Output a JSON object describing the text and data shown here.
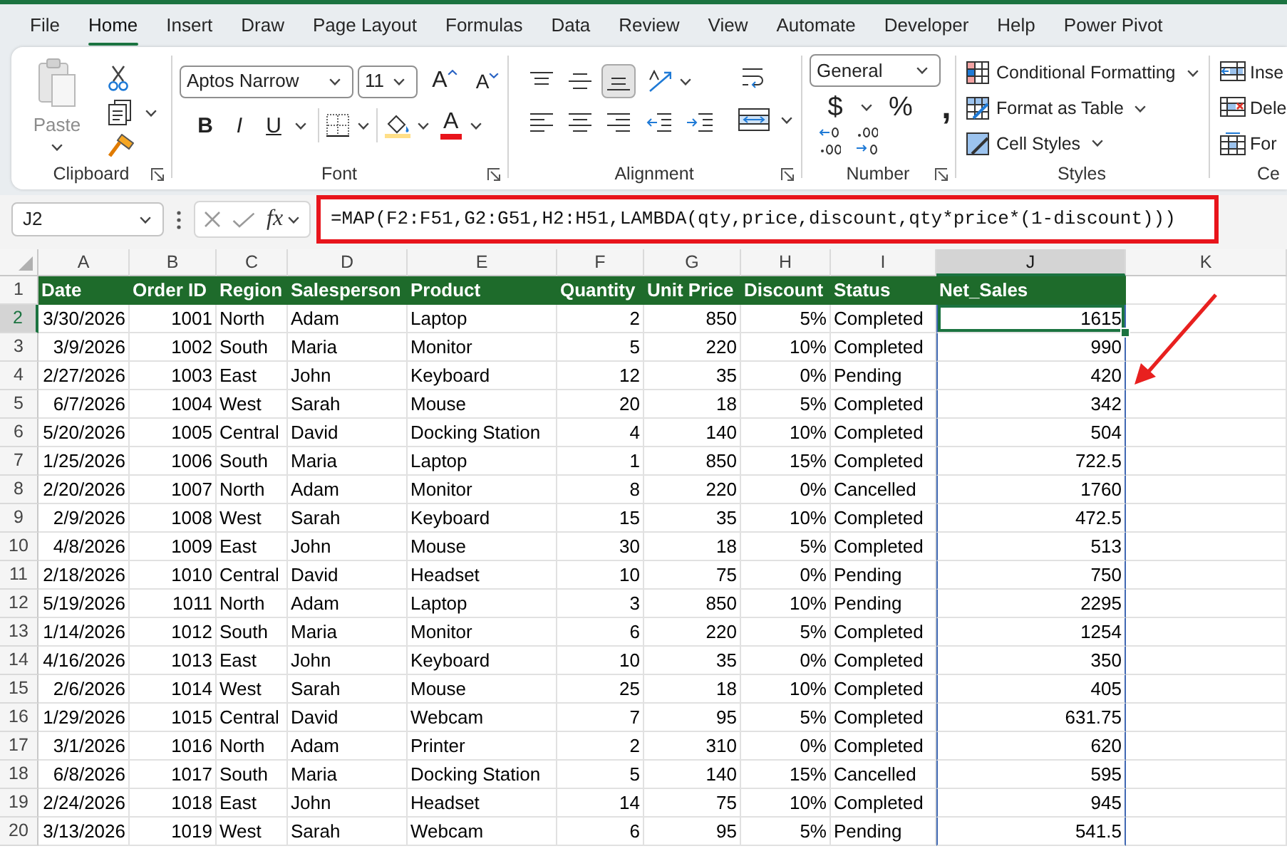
{
  "menu_tabs": [
    {
      "label": "File",
      "selected": false
    },
    {
      "label": "Home",
      "selected": true
    },
    {
      "label": "Insert",
      "selected": false
    },
    {
      "label": "Draw",
      "selected": false
    },
    {
      "label": "Page Layout",
      "selected": false
    },
    {
      "label": "Formulas",
      "selected": false
    },
    {
      "label": "Data",
      "selected": false
    },
    {
      "label": "Review",
      "selected": false
    },
    {
      "label": "View",
      "selected": false
    },
    {
      "label": "Automate",
      "selected": false
    },
    {
      "label": "Developer",
      "selected": false
    },
    {
      "label": "Help",
      "selected": false
    },
    {
      "label": "Power Pivot",
      "selected": false
    }
  ],
  "ribbon": {
    "groups": [
      {
        "kind": "clipboard",
        "label": "Clipboard",
        "launcher": true,
        "paste": {
          "label": "Paste",
          "disabled": true
        }
      },
      {
        "kind": "font",
        "label": "Font",
        "launcher": true,
        "font_name": "Aptos Narrow",
        "font_size": "11",
        "grow_font": "A",
        "shrink_font": "A",
        "bold": "B",
        "italic": "I",
        "underline": "U",
        "font_color": "A"
      },
      {
        "kind": "alignment",
        "label": "Alignment",
        "launcher": true,
        "vertical_align": [
          {
            "kind": "top",
            "selected": false
          },
          {
            "kind": "middle",
            "selected": false
          },
          {
            "kind": "bottom",
            "selected": true
          }
        ]
      },
      {
        "kind": "number",
        "label": "Number",
        "launcher": true,
        "format": "General",
        "currency": "$",
        "percent": "%",
        "comma": ","
      },
      {
        "kind": "styles",
        "label": "Styles",
        "launcher": false,
        "commands": [
          {
            "kind": "conditional",
            "label": "Conditional Formatting"
          },
          {
            "kind": "table",
            "label": "Format as Table"
          },
          {
            "kind": "cell_styles",
            "label": "Cell Styles"
          }
        ]
      },
      {
        "kind": "cells",
        "label": "Ce",
        "launcher": false,
        "commands": [
          {
            "kind": "insert",
            "label": "Inse"
          },
          {
            "kind": "delete",
            "label": "Dele"
          },
          {
            "kind": "format",
            "label": "For"
          }
        ]
      }
    ]
  },
  "formula_bar": {
    "name_box": "J2",
    "function_label": "fx",
    "formula": "=MAP(F2:F51,G2:G51,H2:H51,LAMBDA(qty,price,discount,qty*price*(1-discount)))",
    "highlighted": true
  },
  "sheet": {
    "column_letters": [
      {
        "label": "A",
        "selected": false
      },
      {
        "label": "B",
        "selected": false
      },
      {
        "label": "C",
        "selected": false
      },
      {
        "label": "D",
        "selected": false
      },
      {
        "label": "E",
        "selected": false
      },
      {
        "label": "F",
        "selected": false
      },
      {
        "label": "G",
        "selected": false
      },
      {
        "label": "H",
        "selected": false
      },
      {
        "label": "I",
        "selected": false
      },
      {
        "label": "J",
        "selected": true
      },
      {
        "label": "K",
        "selected": false
      }
    ],
    "header_row": {
      "number": "1",
      "selected": false
    },
    "columns": [
      {
        "header": "Date",
        "kind": "number",
        "spill": false
      },
      {
        "header": "Order ID",
        "kind": "number",
        "spill": false
      },
      {
        "header": "Region",
        "kind": "text",
        "spill": false
      },
      {
        "header": "Salesperson",
        "kind": "text",
        "spill": false
      },
      {
        "header": "Product",
        "kind": "text",
        "spill": false
      },
      {
        "header": "Quantity",
        "kind": "number",
        "spill": false
      },
      {
        "header": "Unit Price",
        "kind": "number",
        "spill": false
      },
      {
        "header": "Discount",
        "kind": "number",
        "spill": false
      },
      {
        "header": "Status",
        "kind": "text",
        "spill": false
      },
      {
        "header": "Net_Sales",
        "kind": "number",
        "spill": true
      }
    ],
    "rows": [
      {
        "number": "2",
        "selected": true,
        "cells": [
          "3/30/2026",
          "1001",
          "North",
          "Adam",
          "Laptop",
          "2",
          "850",
          "5%",
          "Completed",
          "1615"
        ]
      },
      {
        "number": "3",
        "selected": false,
        "cells": [
          "3/9/2026",
          "1002",
          "South",
          "Maria",
          "Monitor",
          "5",
          "220",
          "10%",
          "Completed",
          "990"
        ]
      },
      {
        "number": "4",
        "selected": false,
        "cells": [
          "2/27/2026",
          "1003",
          "East",
          "John",
          "Keyboard",
          "12",
          "35",
          "0%",
          "Pending",
          "420"
        ]
      },
      {
        "number": "5",
        "selected": false,
        "cells": [
          "6/7/2026",
          "1004",
          "West",
          "Sarah",
          "Mouse",
          "20",
          "18",
          "5%",
          "Completed",
          "342"
        ]
      },
      {
        "number": "6",
        "selected": false,
        "cells": [
          "5/20/2026",
          "1005",
          "Central",
          "David",
          "Docking Station",
          "4",
          "140",
          "10%",
          "Completed",
          "504"
        ]
      },
      {
        "number": "7",
        "selected": false,
        "cells": [
          "1/25/2026",
          "1006",
          "South",
          "Maria",
          "Laptop",
          "1",
          "850",
          "15%",
          "Completed",
          "722.5"
        ]
      },
      {
        "number": "8",
        "selected": false,
        "cells": [
          "2/20/2026",
          "1007",
          "North",
          "Adam",
          "Monitor",
          "8",
          "220",
          "0%",
          "Cancelled",
          "1760"
        ]
      },
      {
        "number": "9",
        "selected": false,
        "cells": [
          "2/9/2026",
          "1008",
          "West",
          "Sarah",
          "Keyboard",
          "15",
          "35",
          "10%",
          "Completed",
          "472.5"
        ]
      },
      {
        "number": "10",
        "selected": false,
        "cells": [
          "4/8/2026",
          "1009",
          "East",
          "John",
          "Mouse",
          "30",
          "18",
          "5%",
          "Completed",
          "513"
        ]
      },
      {
        "number": "11",
        "selected": false,
        "cells": [
          "2/18/2026",
          "1010",
          "Central",
          "David",
          "Headset",
          "10",
          "75",
          "0%",
          "Pending",
          "750"
        ]
      },
      {
        "number": "12",
        "selected": false,
        "cells": [
          "5/19/2026",
          "1011",
          "North",
          "Adam",
          "Laptop",
          "3",
          "850",
          "10%",
          "Pending",
          "2295"
        ]
      },
      {
        "number": "13",
        "selected": false,
        "cells": [
          "1/14/2026",
          "1012",
          "South",
          "Maria",
          "Monitor",
          "6",
          "220",
          "5%",
          "Completed",
          "1254"
        ]
      },
      {
        "number": "14",
        "selected": false,
        "cells": [
          "4/16/2026",
          "1013",
          "East",
          "John",
          "Keyboard",
          "10",
          "35",
          "0%",
          "Completed",
          "350"
        ]
      },
      {
        "number": "15",
        "selected": false,
        "cells": [
          "2/6/2026",
          "1014",
          "West",
          "Sarah",
          "Mouse",
          "25",
          "18",
          "10%",
          "Completed",
          "405"
        ]
      },
      {
        "number": "16",
        "selected": false,
        "cells": [
          "1/29/2026",
          "1015",
          "Central",
          "David",
          "Webcam",
          "7",
          "95",
          "5%",
          "Completed",
          "631.75"
        ]
      },
      {
        "number": "17",
        "selected": false,
        "cells": [
          "3/1/2026",
          "1016",
          "North",
          "Adam",
          "Printer",
          "2",
          "310",
          "0%",
          "Completed",
          "620"
        ]
      },
      {
        "number": "18",
        "selected": false,
        "cells": [
          "6/8/2026",
          "1017",
          "South",
          "Maria",
          "Docking Station",
          "5",
          "140",
          "15%",
          "Cancelled",
          "595"
        ]
      },
      {
        "number": "19",
        "selected": false,
        "cells": [
          "2/24/2026",
          "1018",
          "East",
          "John",
          "Headset",
          "14",
          "75",
          "10%",
          "Completed",
          "945"
        ]
      },
      {
        "number": "20",
        "selected": false,
        "cells": [
          "3/13/2026",
          "1019",
          "West",
          "Sarah",
          "Webcam",
          "6",
          "95",
          "5%",
          "Pending",
          "541.5"
        ]
      }
    ]
  }
}
